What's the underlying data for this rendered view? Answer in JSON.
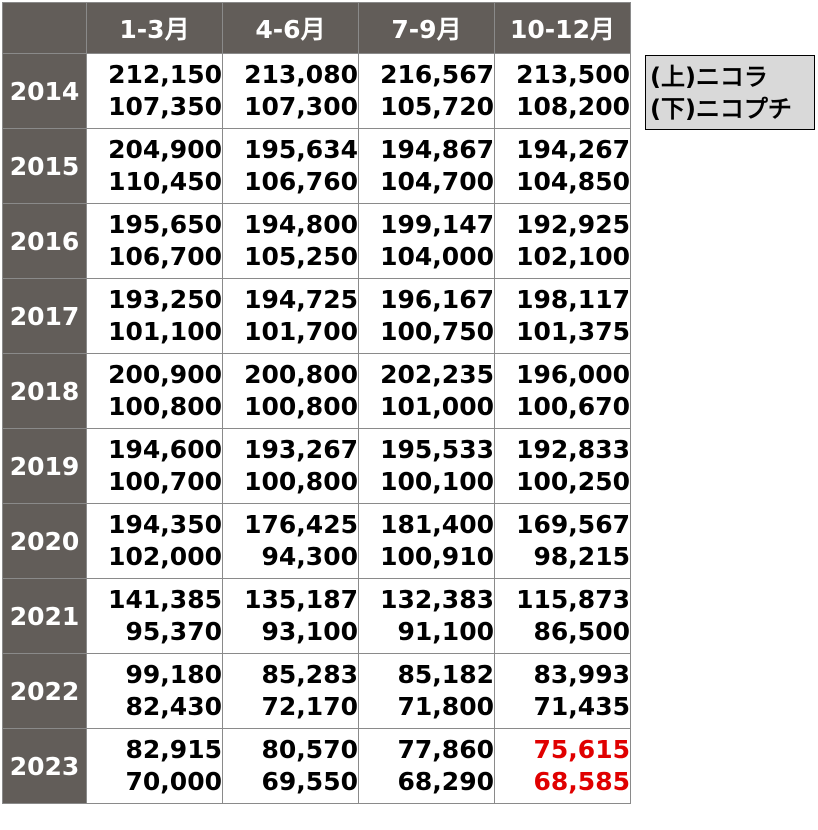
{
  "columns": [
    "1-3月",
    "4-6月",
    "7-9月",
    "10-12月"
  ],
  "rows": [
    {
      "year": "2014",
      "cells": [
        [
          "212,150",
          "107,350"
        ],
        [
          "213,080",
          "107,300"
        ],
        [
          "216,567",
          "105,720"
        ],
        [
          "213,500",
          "108,200"
        ]
      ]
    },
    {
      "year": "2015",
      "cells": [
        [
          "204,900",
          "110,450"
        ],
        [
          "195,634",
          "106,760"
        ],
        [
          "194,867",
          "104,700"
        ],
        [
          "194,267",
          "104,850"
        ]
      ]
    },
    {
      "year": "2016",
      "cells": [
        [
          "195,650",
          "106,700"
        ],
        [
          "194,800",
          "105,250"
        ],
        [
          "199,147",
          "104,000"
        ],
        [
          "192,925",
          "102,100"
        ]
      ]
    },
    {
      "year": "2017",
      "cells": [
        [
          "193,250",
          "101,100"
        ],
        [
          "194,725",
          "101,700"
        ],
        [
          "196,167",
          "100,750"
        ],
        [
          "198,117",
          "101,375"
        ]
      ]
    },
    {
      "year": "2018",
      "cells": [
        [
          "200,900",
          "100,800"
        ],
        [
          "200,800",
          "100,800"
        ],
        [
          "202,235",
          "101,000"
        ],
        [
          "196,000",
          "100,670"
        ]
      ]
    },
    {
      "year": "2019",
      "cells": [
        [
          "194,600",
          "100,700"
        ],
        [
          "193,267",
          "100,800"
        ],
        [
          "195,533",
          "100,100"
        ],
        [
          "192,833",
          "100,250"
        ]
      ]
    },
    {
      "year": "2020",
      "cells": [
        [
          "194,350",
          "102,000"
        ],
        [
          "176,425",
          "94,300"
        ],
        [
          "181,400",
          "100,910"
        ],
        [
          "169,567",
          "98,215"
        ]
      ]
    },
    {
      "year": "2021",
      "cells": [
        [
          "141,385",
          "95,370"
        ],
        [
          "135,187",
          "93,100"
        ],
        [
          "132,383",
          "91,100"
        ],
        [
          "115,873",
          "86,500"
        ]
      ]
    },
    {
      "year": "2022",
      "cells": [
        [
          "99,180",
          "82,430"
        ],
        [
          "85,283",
          "72,170"
        ],
        [
          "85,182",
          "71,800"
        ],
        [
          "83,993",
          "71,435"
        ]
      ]
    },
    {
      "year": "2023",
      "cells": [
        [
          "82,915",
          "70,000"
        ],
        [
          "80,570",
          "69,550"
        ],
        [
          "77,860",
          "68,290"
        ],
        [
          "75,615",
          "68,585"
        ]
      ]
    }
  ],
  "highlight": {
    "row": 9,
    "col": 3,
    "color": "#e00000"
  },
  "legend": {
    "top": "(上)ニコラ",
    "bottom": "(下)ニコプチ"
  },
  "colors": {
    "header_bg": "#625d59",
    "header_text": "#ffffff",
    "legend_bg": "#d9d9d9"
  }
}
